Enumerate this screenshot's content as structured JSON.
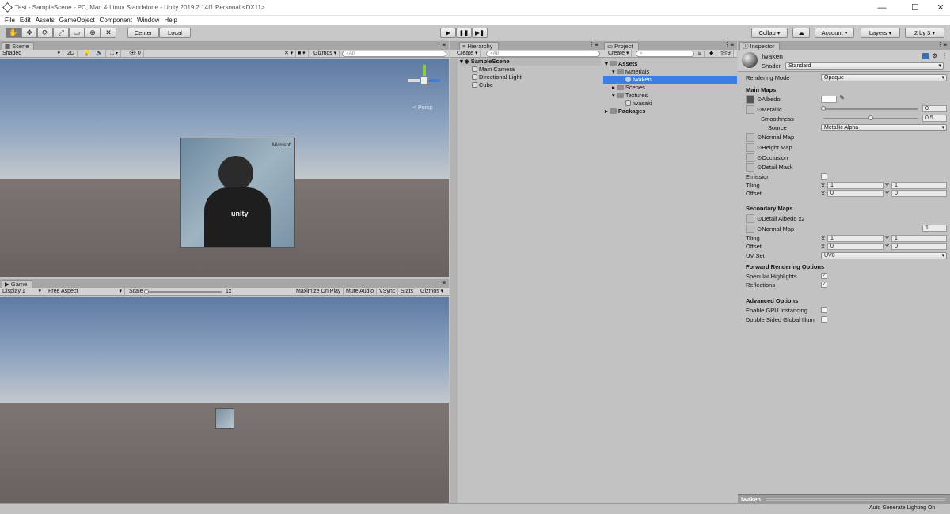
{
  "window": {
    "title": "Test - SampleScene - PC, Mac & Linux Standalone - Unity 2019.2.14f1 Personal <DX11>",
    "minimize": "—",
    "maximize": "☐",
    "close": "✕"
  },
  "menu": [
    "File",
    "Edit",
    "Assets",
    "GameObject",
    "Component",
    "Window",
    "Help"
  ],
  "toolbar": {
    "pivot": "Center",
    "space": "Local",
    "play": "▶",
    "pause": "❚❚",
    "step": "▶❚",
    "collab": "Collab",
    "account": "Account",
    "layers": "Layers",
    "layout": "2 by 3"
  },
  "scene": {
    "tab": "Scene",
    "shading": "Shaded",
    "mode2d": "2D",
    "hidden_count": "0",
    "gizmos": "Gizmos",
    "search_placeholder": "All",
    "persp": "< Persp"
  },
  "game": {
    "tab": "Game",
    "display": "Display 1",
    "aspect": "Free Aspect",
    "scale_label": "Scale",
    "scale_value": "1x",
    "maximize": "Maximize On Play",
    "mute": "Mute Audio",
    "vsync": "VSync",
    "stats": "Stats",
    "gizmos": "Gizmos"
  },
  "hierarchy": {
    "tab": "Hierarchy",
    "create": "Create",
    "search_placeholder": "All",
    "scene": "SampleScene",
    "items": [
      "Main Camera",
      "Directional Light",
      "Cube"
    ]
  },
  "project": {
    "tab": "Project",
    "create": "Create",
    "count": "9",
    "tree": {
      "assets": "Assets",
      "materials": "Materials",
      "selected": "Iwaken",
      "scenes": "Scenes",
      "textures": "Textures",
      "texture_item": "iwasaki",
      "packages": "Packages"
    }
  },
  "inspector": {
    "tab": "Inspector",
    "material": "Iwaken",
    "shader_label": "Shader",
    "shader": "Standard",
    "rendering_mode_label": "Rendering Mode",
    "rendering_mode": "Opaque",
    "main_maps": "Main Maps",
    "albedo": "Albedo",
    "metallic": "Metallic",
    "metallic_value": "0",
    "smoothness": "Smoothness",
    "smoothness_value": "0.5",
    "source": "Source",
    "source_value": "Metallic Alpha",
    "normal_map": "Normal Map",
    "height_map": "Height Map",
    "occlusion": "Occlusion",
    "detail_mask": "Detail Mask",
    "emission": "Emission",
    "tiling": "Tiling",
    "offset": "Offset",
    "x": "X",
    "y": "Y",
    "tiling_x": "1",
    "tiling_y": "1",
    "offset_x": "0",
    "offset_y": "0",
    "secondary_maps": "Secondary Maps",
    "detail_albedo": "Detail Albedo x2",
    "normal_map2": "Normal Map",
    "normal_map2_value": "1",
    "tiling2_x": "1",
    "tiling2_y": "1",
    "offset2_x": "0",
    "offset2_y": "0",
    "uv_set": "UV Set",
    "uv_set_value": "UV0",
    "forward": "Forward Rendering Options",
    "specular": "Specular Highlights",
    "reflections": "Reflections",
    "advanced": "Advanced Options",
    "gpu_instancing": "Enable GPU Instancing",
    "double_sided": "Double Sided Global Illum",
    "preview_name": "Iwaken"
  },
  "overlay": {
    "brand": "Microsoft",
    "logo": "unity"
  },
  "status": {
    "right": "Auto Generate Lighting On"
  },
  "colors": {
    "selection": "#3d7ee6",
    "panel": "#c2c2c2"
  }
}
